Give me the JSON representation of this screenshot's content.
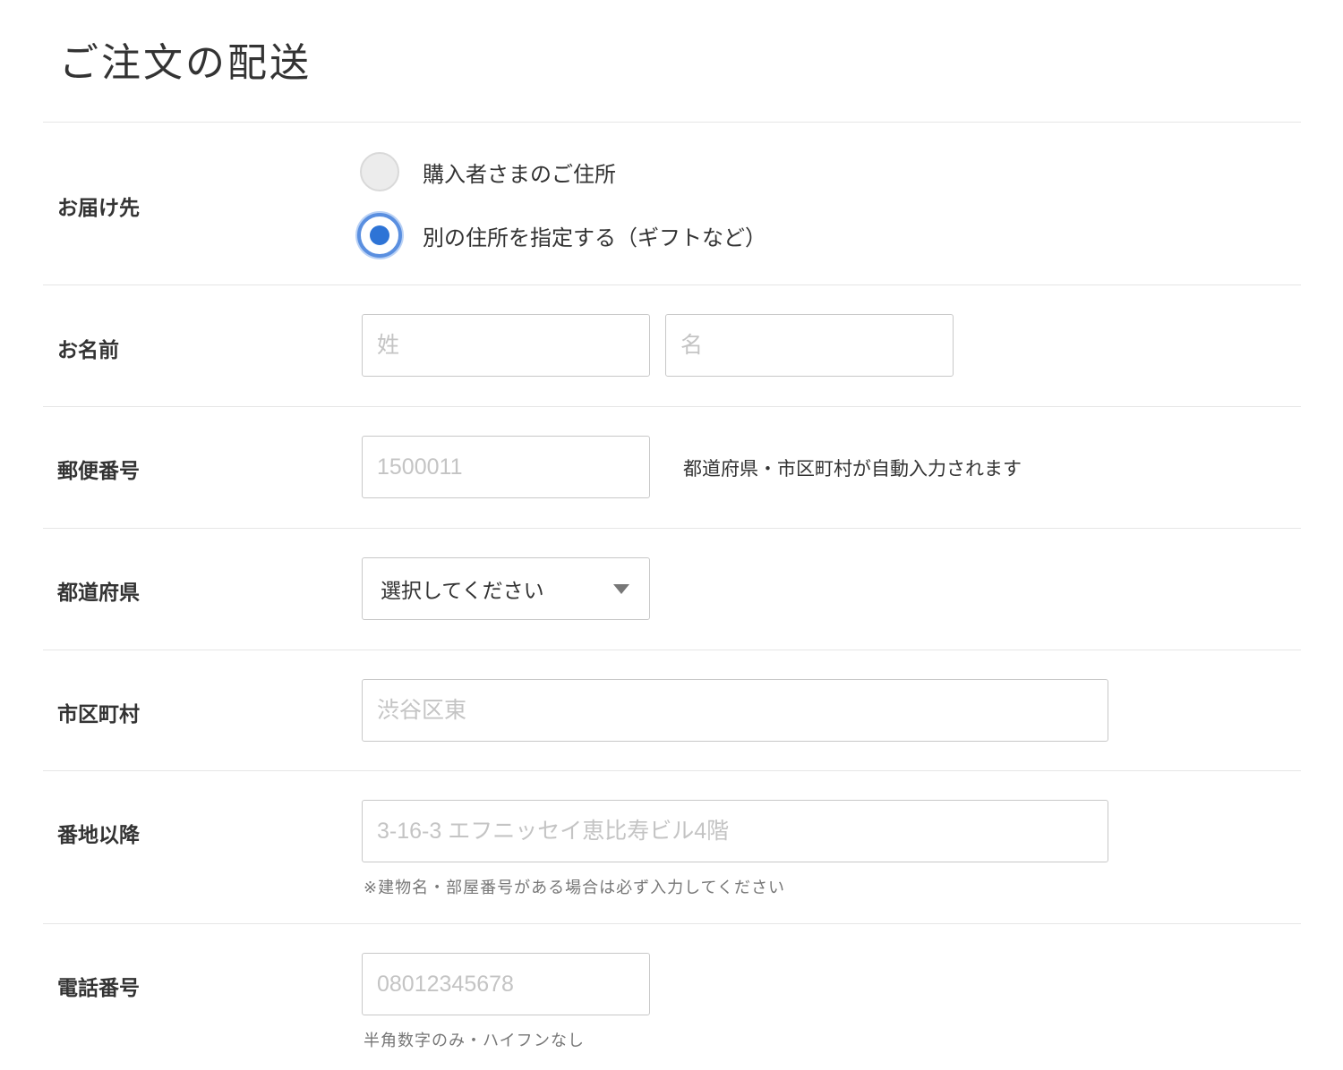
{
  "page": {
    "title": "ご注文の配送"
  },
  "form": {
    "delivery": {
      "label": "お届け先",
      "options": [
        {
          "label": "購入者さまのご住所",
          "checked": false
        },
        {
          "label": "別の住所を指定する（ギフトなど）",
          "checked": true
        }
      ]
    },
    "name": {
      "label": "お名前",
      "last_placeholder": "姓",
      "first_placeholder": "名"
    },
    "postal": {
      "label": "郵便番号",
      "placeholder": "1500011",
      "helper": "都道府県・市区町村が自動入力されます"
    },
    "prefecture": {
      "label": "都道府県",
      "selected": "選択してください",
      "caret_icon": "triangle-down-icon"
    },
    "city": {
      "label": "市区町村",
      "placeholder": "渋谷区東"
    },
    "address": {
      "label": "番地以降",
      "placeholder": "3-16-3 エフニッセイ恵比寿ビル4階",
      "note": "※建物名・部屋番号がある場合は必ず入力してください"
    },
    "phone": {
      "label": "電話番号",
      "placeholder": "08012345678",
      "note": "半角数字のみ・ハイフンなし"
    }
  },
  "colors": {
    "accent": "#2e74d6",
    "focus_ring": "#5a8fe0",
    "divider": "#e6e6e6",
    "input_border": "#c8c8c8",
    "placeholder": "#c4c4c4"
  }
}
